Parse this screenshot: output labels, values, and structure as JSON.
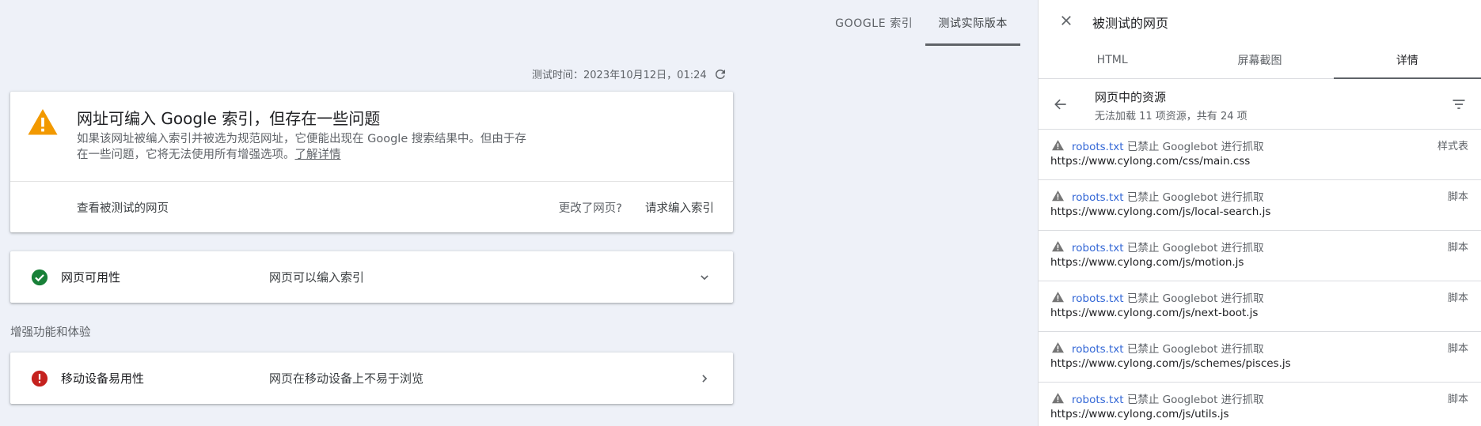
{
  "top_tabs": [
    {
      "label": "GOOGLE 索引"
    },
    {
      "label": "测试实际版本"
    }
  ],
  "test_time": "测试时间：2023年10月12日，01:24",
  "status_card": {
    "title": "网址可编入 Google 索引，但存在一些问题",
    "description": "如果该网址被编入索引并被选为规范网址，它便能出现在 Google 搜索结果中。但由于存在一些问题，它将无法使用所有增强选项。",
    "learn_more": "了解详情",
    "view_tested_page": "查看被测试的网页",
    "page_changed": "更改了网页?",
    "request_indexing": "请求编入索引"
  },
  "availability": {
    "label": "网页可用性",
    "value": "网页可以编入索引"
  },
  "enhancements_heading": "增强功能和体验",
  "mobile": {
    "label": "移动设备易用性",
    "value": "网页在移动设备上不易于浏览"
  },
  "panel": {
    "title": "被测试的网页",
    "tabs": [
      {
        "label": "HTML"
      },
      {
        "label": "屏幕截图"
      },
      {
        "label": "详情"
      }
    ],
    "resources_title": "网页中的资源",
    "resources_subtitle": "无法加载 11 项资源，共有 24 项",
    "items": [
      {
        "robots": "robots.txt",
        "reason": " 已禁止 Googlebot 进行抓取",
        "url": "https://www.cylong.com/css/main.css",
        "type": "样式表"
      },
      {
        "robots": "robots.txt",
        "reason": " 已禁止 Googlebot 进行抓取",
        "url": "https://www.cylong.com/js/local-search.js",
        "type": "脚本"
      },
      {
        "robots": "robots.txt",
        "reason": " 已禁止 Googlebot 进行抓取",
        "url": "https://www.cylong.com/js/motion.js",
        "type": "脚本"
      },
      {
        "robots": "robots.txt",
        "reason": " 已禁止 Googlebot 进行抓取",
        "url": "https://www.cylong.com/js/next-boot.js",
        "type": "脚本"
      },
      {
        "robots": "robots.txt",
        "reason": " 已禁止 Googlebot 进行抓取",
        "url": "https://www.cylong.com/js/schemes/pisces.js",
        "type": "脚本"
      },
      {
        "robots": "robots.txt",
        "reason": " 已禁止 Googlebot 进行抓取",
        "url": "https://www.cylong.com/js/utils.js",
        "type": "脚本"
      }
    ]
  },
  "colors": {
    "background": "#eef1f8",
    "warning": "#f29900",
    "success": "#188038",
    "error": "#c5221f",
    "link": "#3367d6"
  },
  "icons": [
    "warning-icon",
    "refresh-icon",
    "check-circle-icon",
    "error-icon",
    "chevron-down-icon",
    "chevron-right-icon",
    "close-icon",
    "back-arrow-icon",
    "filter-icon"
  ]
}
